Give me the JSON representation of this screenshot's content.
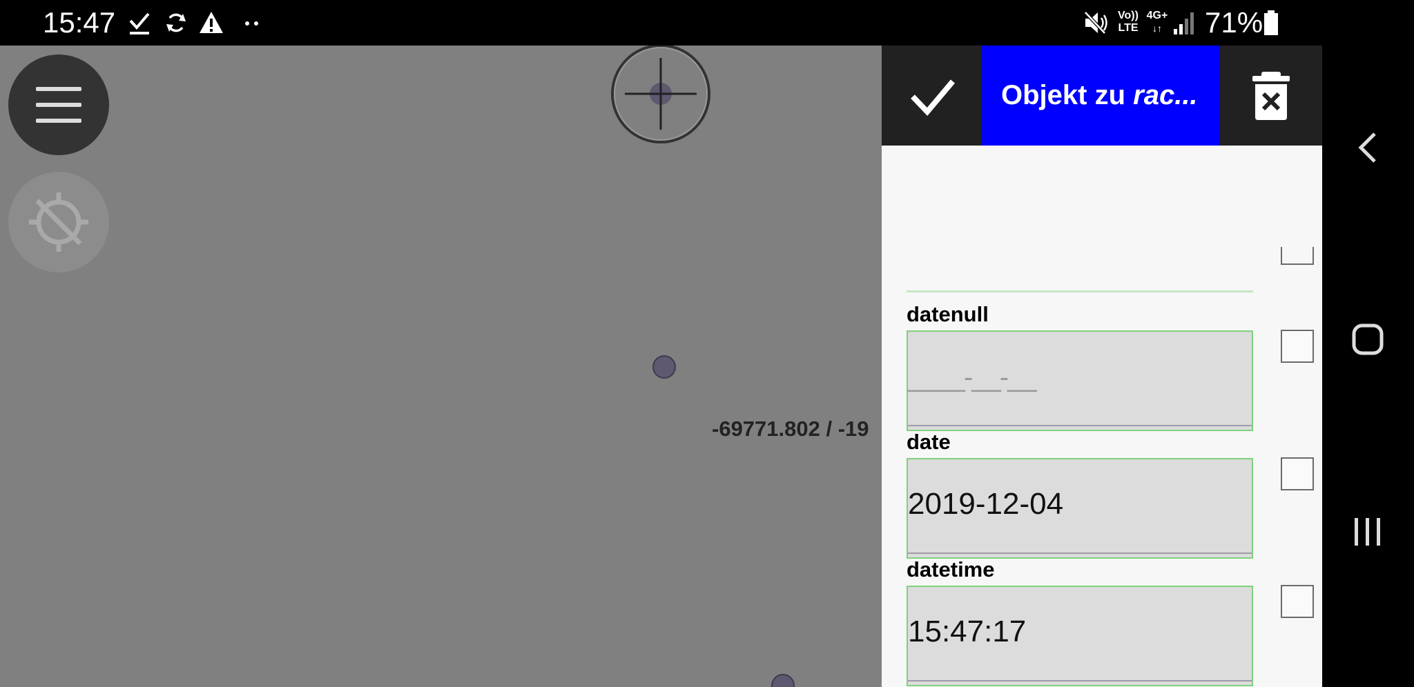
{
  "status_bar": {
    "time": "15:47",
    "battery_percent": "71%",
    "network_top": "Vo))",
    "network_bottom": "LTE",
    "network_type": "4G+",
    "icons": [
      "check-download-icon",
      "sync-icon",
      "warning-icon",
      "more-dots-icon",
      "mute-icon",
      "volte-icon",
      "4g-data-icon",
      "signal-icon",
      "battery-icon"
    ]
  },
  "map": {
    "coordinate_text": "-69771.802 / -19",
    "menu_button_icon": "hamburger-menu-icon",
    "gps_button_icon": "gps-off-icon",
    "crosshair_icon": "crosshair-icon"
  },
  "panel": {
    "title_regular": "Objekt zu ",
    "title_italic": "rac...",
    "confirm_icon": "check-icon",
    "delete_icon": "delete-icon",
    "fields": [
      {
        "label": "datenull",
        "value": "",
        "placeholder": "____-__-__"
      },
      {
        "label": "date",
        "value": "2019-12-04",
        "placeholder": ""
      },
      {
        "label": "datetime",
        "value": "15:47:17",
        "placeholder": ""
      }
    ]
  },
  "nav_bar": {
    "icons": [
      "back-icon",
      "home-icon",
      "recents-icon"
    ]
  },
  "colors": {
    "toolbar_title_bg": "#0000ff",
    "toolbar_bg": "#212121",
    "map_bg": "#808080",
    "field_border": "#7ed07e",
    "field_bg": "#dcdcdc"
  }
}
